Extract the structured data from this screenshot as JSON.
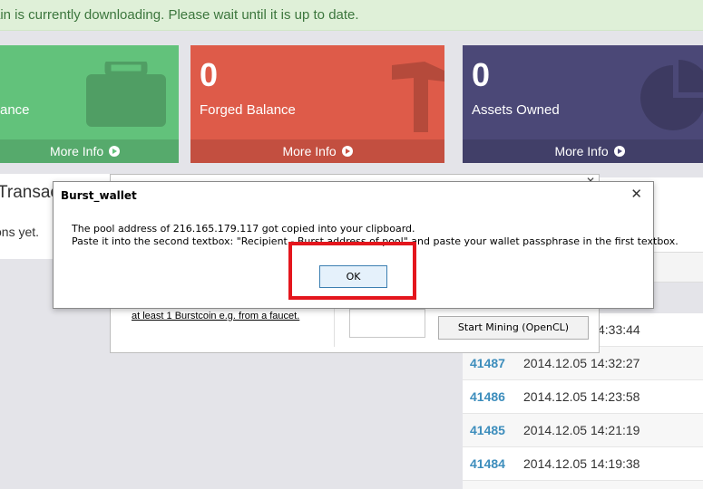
{
  "alert": {
    "text": "ain is currently downloading. Please wait until it is up to date."
  },
  "tiles": [
    {
      "value": "",
      "label": "ance",
      "more": "More Info",
      "icon": "briefcase-icon",
      "color": "#62c27b"
    },
    {
      "value": "0",
      "label": "Forged Balance",
      "more": "More Info",
      "icon": "hammer-icon",
      "color": "#de5b49"
    },
    {
      "value": "0",
      "label": "Assets Owned",
      "more": "More Info",
      "icon": "pie-chart-icon",
      "color": "#4b4877"
    }
  ],
  "transactions_panel": {
    "heading": "Transac",
    "text": "ons yet."
  },
  "mining_window": {
    "link_text": "at least 1 Burstcoin e.g. from a faucet.",
    "start_button": "Start Mining (OpenCL)"
  },
  "dialog": {
    "title": "Burst_wallet",
    "line1": "The pool address  of 216.165.179.117 got copied into your clipboard.",
    "line2": "Paste it into the second textbox: \"Recipient - Burst address of pool\" and paste your wallet passphrase in the first textbox.",
    "ok_label": "OK"
  },
  "blocks": [
    {
      "id": "",
      "time": "4:33:44"
    },
    {
      "id": "41487",
      "time": "2014.12.05 14:32:27"
    },
    {
      "id": "41486",
      "time": "2014.12.05 14:23:58"
    },
    {
      "id": "41485",
      "time": "2014.12.05 14:21:19"
    },
    {
      "id": "41484",
      "time": "2014.12.05 14:19:38"
    },
    {
      "id": "",
      "time": ""
    }
  ],
  "colors": {
    "accent_link": "#3c8dbc",
    "highlight": "#e4161d"
  }
}
